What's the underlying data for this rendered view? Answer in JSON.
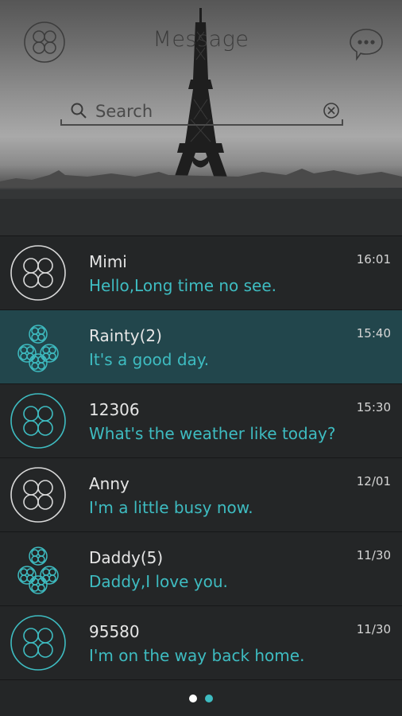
{
  "header": {
    "title": "Message",
    "menu_icon": "flower-logo-icon",
    "more_icon": "chat-bubble-more-icon"
  },
  "search": {
    "placeholder": "Search",
    "icon": "search-icon",
    "clear_icon": "clear-icon"
  },
  "conversations": [
    {
      "name": "Mimi",
      "message": "Hello,Long time no see.",
      "time": "16:01",
      "avatar": "single-contact-avatar",
      "avatar_color": "#d9d9d9",
      "selected": false
    },
    {
      "name": "Rainty(2)",
      "message": "It's a good day.",
      "time": "15:40",
      "avatar": "group-contact-avatar",
      "avatar_color": "#3ebcc1",
      "selected": true
    },
    {
      "name": "12306",
      "message": "What's the weather like today?",
      "time": "15:30",
      "avatar": "single-contact-avatar",
      "avatar_color": "#3ebcc1",
      "selected": false
    },
    {
      "name": "Anny",
      "message": "I'm a little busy now.",
      "time": "12/01",
      "avatar": "single-contact-avatar",
      "avatar_color": "#d9d9d9",
      "selected": false
    },
    {
      "name": "Daddy(5)",
      "message": "Daddy,I love you.",
      "time": "11/30",
      "avatar": "group-contact-avatar",
      "avatar_color": "#3ebcc1",
      "selected": false
    },
    {
      "name": "95580",
      "message": "I'm on the way back home.",
      "time": "11/30",
      "avatar": "single-contact-avatar",
      "avatar_color": "#3ebcc1",
      "selected": false
    }
  ],
  "pager": {
    "total": 2,
    "current": 2,
    "active_color": "#3ebcc1",
    "inactive_color": "#ffffff"
  },
  "colors": {
    "accent": "#3ebcc1",
    "background": "#242627",
    "selected_row": "#22464c"
  }
}
